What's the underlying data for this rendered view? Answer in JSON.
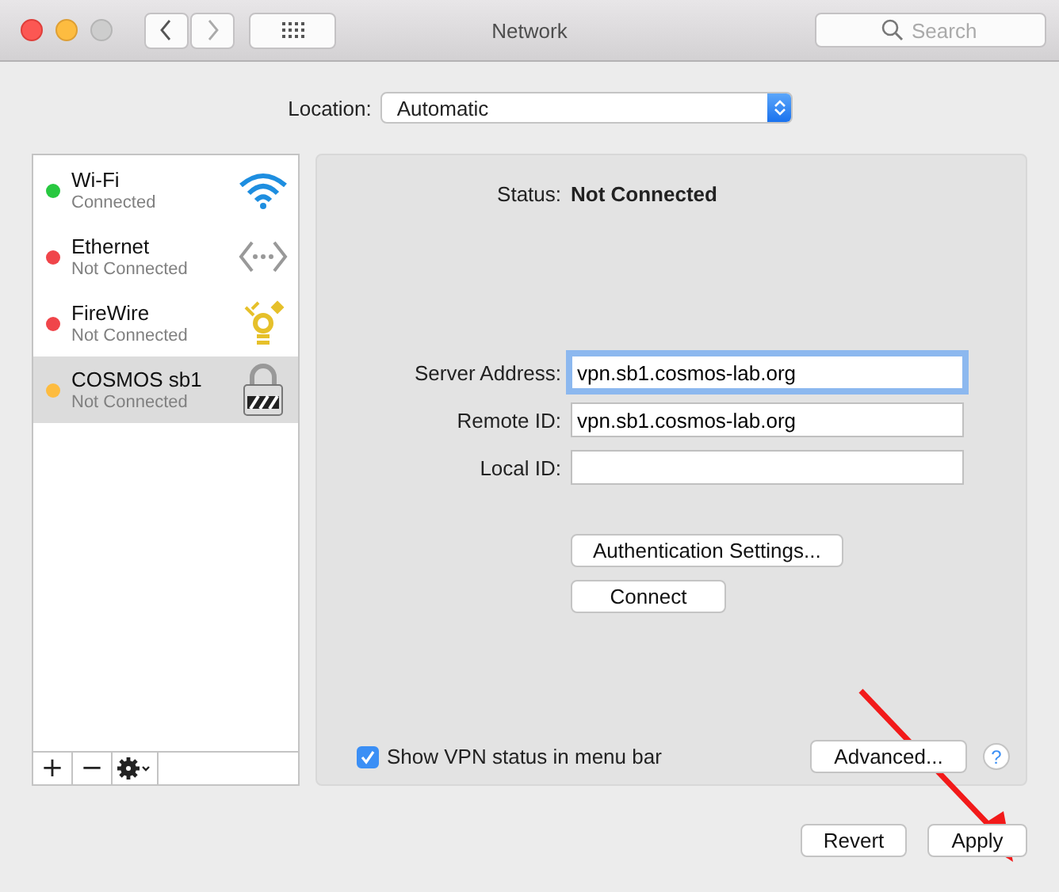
{
  "window": {
    "title": "Network",
    "search": {
      "placeholder": "Search"
    }
  },
  "location": {
    "label": "Location:",
    "value": "Automatic"
  },
  "services": [
    {
      "name": "Wi-Fi",
      "status": "Connected",
      "color": "#28c840",
      "kind": "wifi",
      "selected": false
    },
    {
      "name": "Ethernet",
      "status": "Not Connected",
      "color": "#f0454a",
      "kind": "ethernet",
      "selected": false
    },
    {
      "name": "FireWire",
      "status": "Not Connected",
      "color": "#f0454a",
      "kind": "firewire",
      "selected": false
    },
    {
      "name": "COSMOS sb1",
      "status": "Not Connected",
      "color": "#fdbc40",
      "kind": "vpn",
      "selected": true
    }
  ],
  "list_buttons": [
    {
      "kind": "add",
      "label": "+"
    },
    {
      "kind": "remove",
      "label": "−"
    },
    {
      "kind": "gear"
    }
  ],
  "status": {
    "label": "Status:",
    "value": "Not Connected"
  },
  "fields": [
    {
      "label": "Server Address:",
      "value": "vpn.sb1.cosmos-lab.org",
      "focused": true
    },
    {
      "label": "Remote ID:",
      "value": "vpn.sb1.cosmos-lab.org",
      "focused": false
    },
    {
      "label": "Local ID:",
      "focused": false
    }
  ],
  "actions": [
    "Authentication Settings...",
    "Connect"
  ],
  "show_vpn_status": {
    "label": "Show VPN status in menu bar",
    "checked": true
  },
  "advanced_button": "Advanced...",
  "help_button": "?",
  "footer_buttons": [
    "Revert",
    "Apply"
  ]
}
